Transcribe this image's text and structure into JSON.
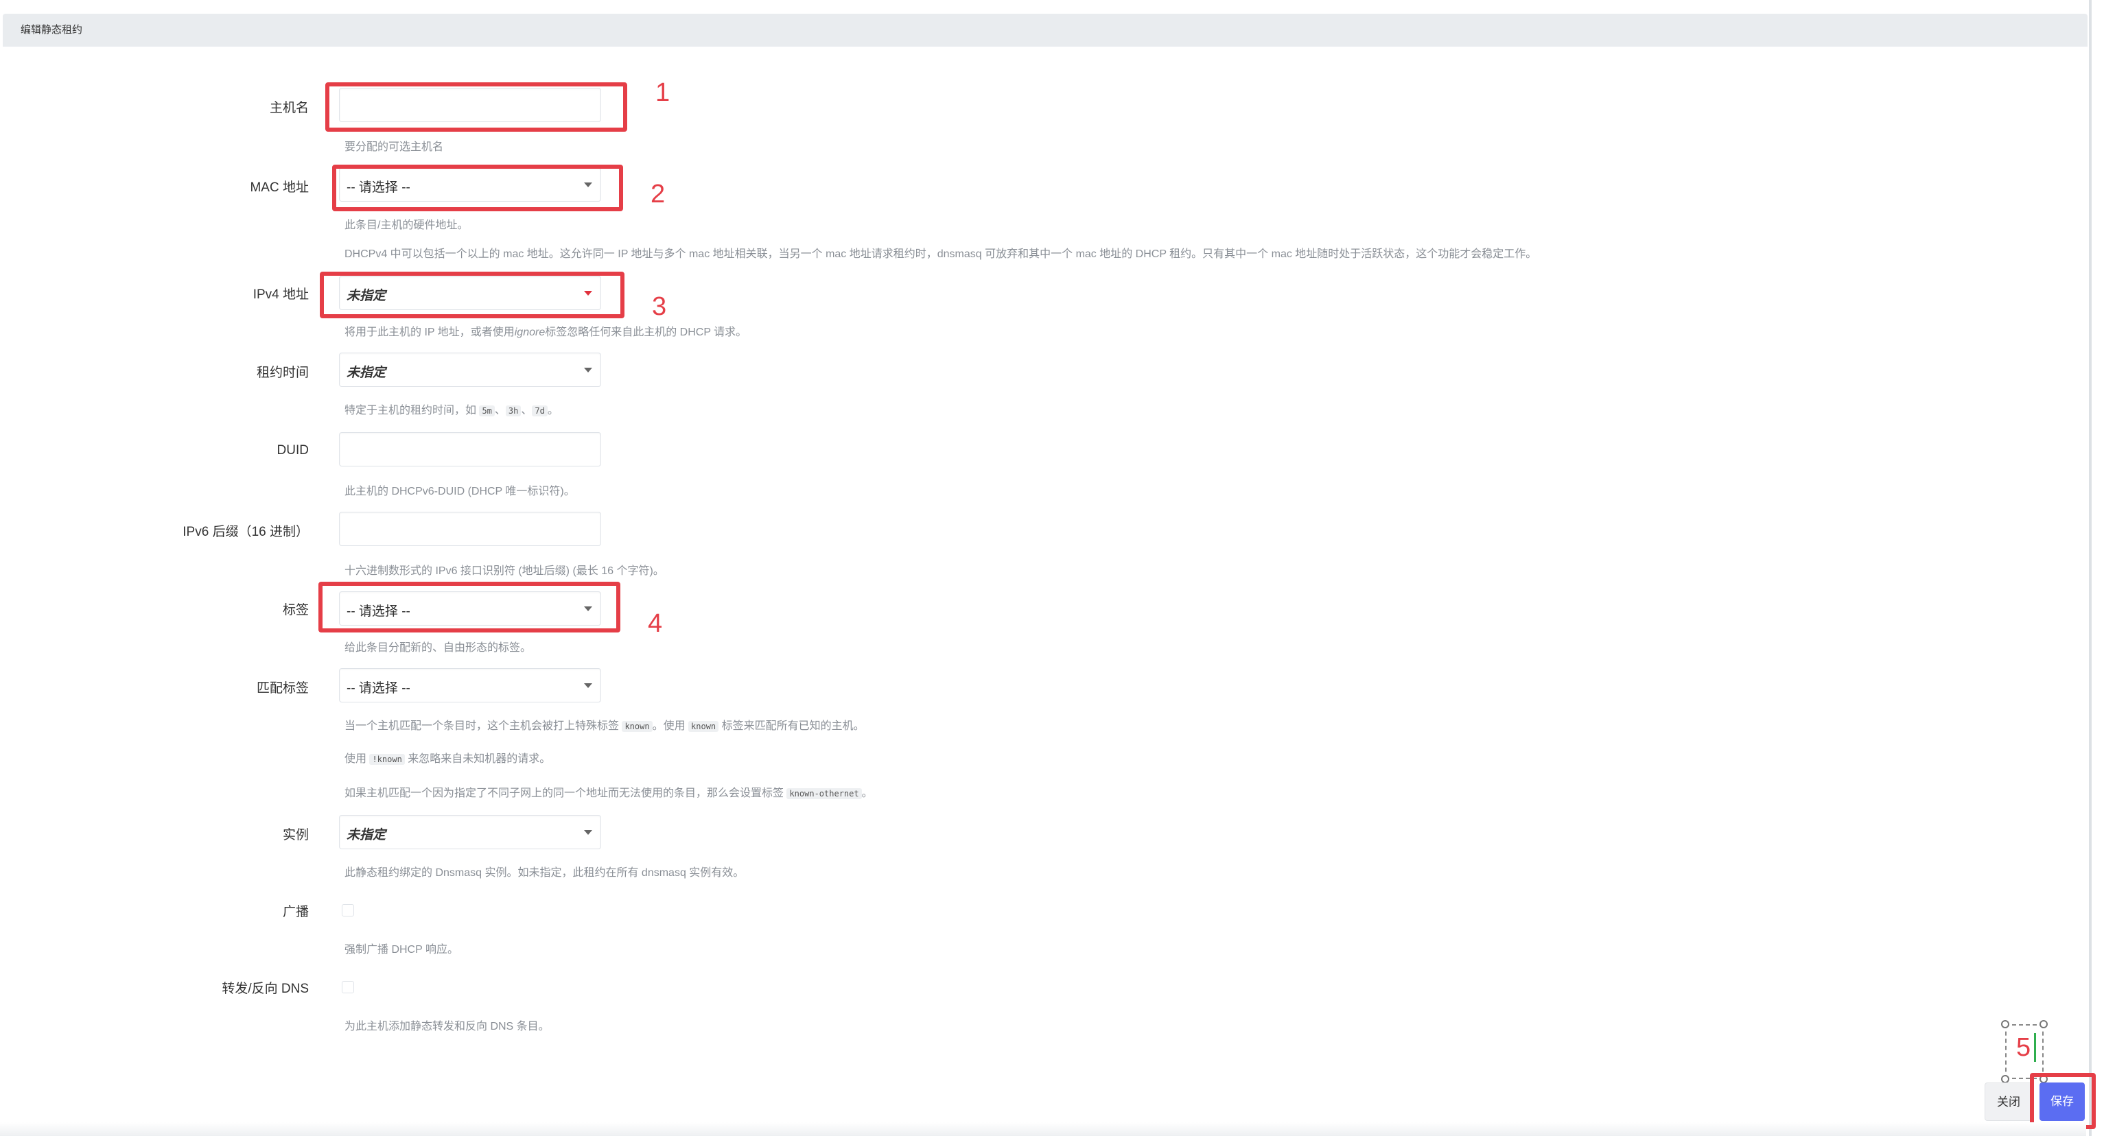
{
  "dialog": {
    "title": "编辑静态租约"
  },
  "form": {
    "hostname": {
      "label": "主机名",
      "value": "",
      "hint": "要分配的可选主机名"
    },
    "mac": {
      "label": "MAC 地址",
      "value": "-- 请选择 --",
      "hint1": "此条目/主机的硬件地址。",
      "hint2": "DHCPv4 中可以包括一个以上的 mac 地址。这允许同一 IP 地址与多个 mac 地址相关联，当另一个 mac 地址请求租约时，dnsmasq 可放弃和其中一个 mac 地址的 DHCP 租约。只有其中一个 mac 地址随时处于活跃状态，这个功能才会稳定工作。"
    },
    "ipv4": {
      "label": "IPv4 地址",
      "value": "未指定",
      "hint_a": "将用于此主机的 IP 地址，或者使用",
      "hint_b": "ignore",
      "hint_c": "标签忽略任何来自此主机的 DHCP 请求。"
    },
    "lease": {
      "label": "租约时间",
      "value": "未指定",
      "hint_a": "特定于主机的租约时间，如 ",
      "code1": "5m",
      "sep1": "、",
      "code2": "3h",
      "sep2": "、",
      "code3": "7d",
      "hint_end": "。"
    },
    "duid": {
      "label": "DUID",
      "value": "",
      "hint": "此主机的 DHCPv6-DUID (DHCP 唯一标识符)。"
    },
    "ipv6suffix": {
      "label": "IPv6 后缀（16 进制）",
      "value": "",
      "hint": "十六进制数形式的 IPv6 接口识别符 (地址后缀) (最长 16 个字符)。"
    },
    "tag": {
      "label": "标签",
      "value": "-- 请选择 --",
      "hint": "给此条目分配新的、自由形态的标签。"
    },
    "match_tag": {
      "label": "匹配标签",
      "value": "-- 请选择 --",
      "hint1_a": "当一个主机匹配一个条目时，这个主机会被打上特殊标签 ",
      "hint1_code1": "known",
      "hint1_b": "。使用 ",
      "hint1_code2": "known",
      "hint1_c": " 标签来匹配所有已知的主机。",
      "hint2_a": "使用 ",
      "hint2_code": "!known",
      "hint2_b": " 来忽略来自未知机器的请求。",
      "hint3_a": "如果主机匹配一个因为指定了不同子网上的同一个地址而无法使用的条目，那么会设置标签 ",
      "hint3_code": "known-othernet",
      "hint3_b": "。"
    },
    "instance": {
      "label": "实例",
      "value": "未指定",
      "hint": "此静态租约绑定的 Dnsmasq 实例。如未指定，此租约在所有 dnsmasq 实例有效。"
    },
    "broadcast": {
      "label": "广播",
      "checked": false,
      "hint": "强制广播 DHCP 响应。"
    },
    "dns": {
      "label": "转发/反向 DNS",
      "checked": false,
      "hint": "为此主机添加静态转发和反向 DNS 条目。"
    }
  },
  "annotations": [
    "1",
    "2",
    "3",
    "4",
    "5"
  ],
  "buttons": {
    "close": "关闭",
    "save": "保存"
  },
  "colors": {
    "highlight": "#e53e47",
    "primary": "#5b6df2",
    "header_bg": "#e9ecef"
  }
}
